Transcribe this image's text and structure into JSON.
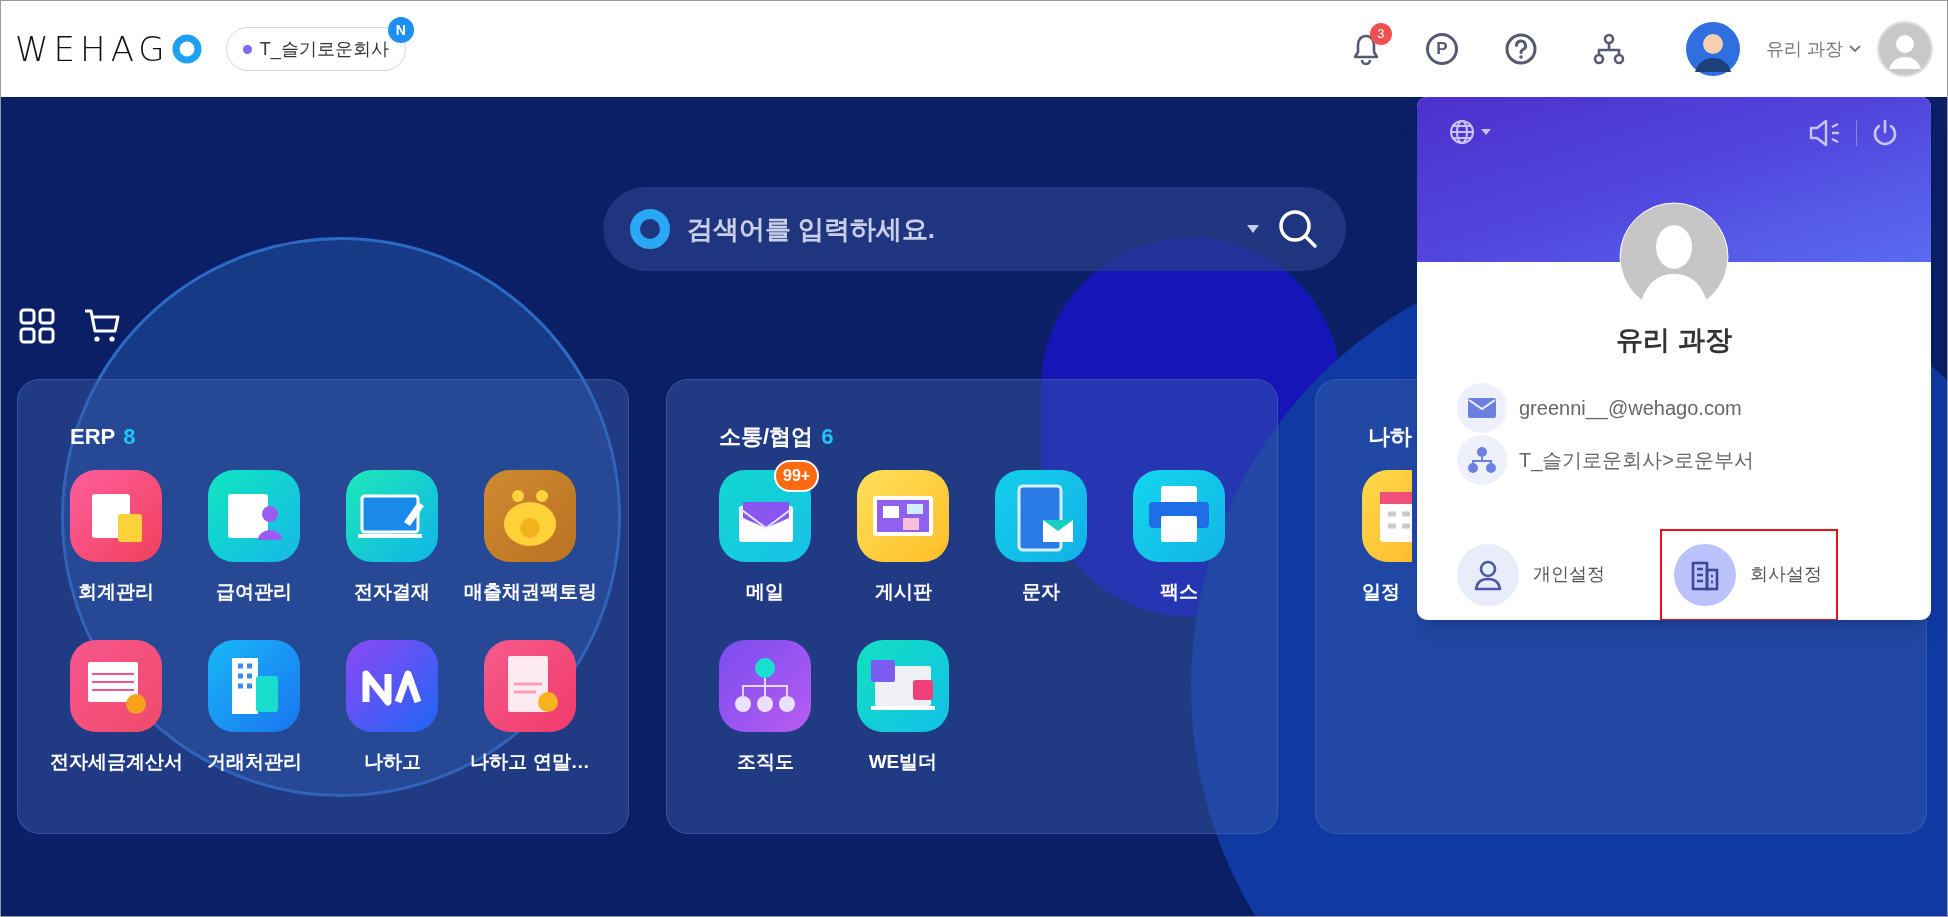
{
  "header": {
    "logo": "WEHAG",
    "company": {
      "name": "T_슬기로운회사",
      "badge": "N"
    },
    "notifications": {
      "count": "3"
    },
    "points_label": "P",
    "user_name": "유리 과장"
  },
  "search": {
    "placeholder": "검색어를 입력하세요."
  },
  "cards": [
    {
      "title": "ERP",
      "count": "8",
      "apps": [
        {
          "label": "회계관리"
        },
        {
          "label": "급여관리"
        },
        {
          "label": "전자결재"
        },
        {
          "label": "매출채권팩토링"
        },
        {
          "label": "전자세금계산서"
        },
        {
          "label": "거래처관리"
        },
        {
          "label": "나하고"
        },
        {
          "label": "나하고 연말…"
        }
      ]
    },
    {
      "title": "소통/협업",
      "count": "6",
      "apps": [
        {
          "label": "메일",
          "badge": "99+"
        },
        {
          "label": "게시판"
        },
        {
          "label": "문자"
        },
        {
          "label": "팩스"
        },
        {
          "label": "조직도"
        },
        {
          "label": "WE빌더"
        }
      ]
    },
    {
      "title": "나하",
      "apps": [
        {
          "label": "일정"
        }
      ]
    }
  ],
  "profile_panel": {
    "name": "유리 과장",
    "email": "greenni__@wehago.com",
    "organization": "T_슬기로운회사>로운부서",
    "settings": [
      {
        "label": "개인설정",
        "highlighted": false
      },
      {
        "label": "회사설정",
        "highlighted": true
      }
    ]
  }
}
